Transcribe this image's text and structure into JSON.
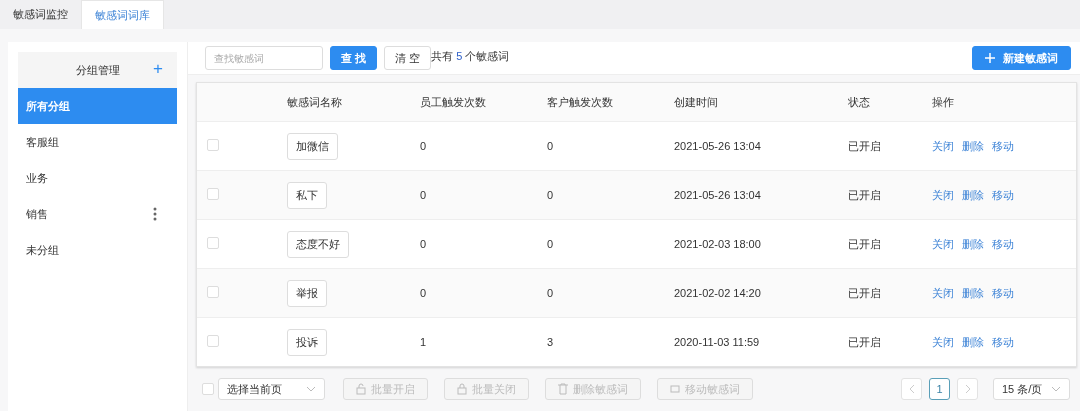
{
  "tabs": [
    {
      "label": "敏感词监控",
      "selected": false
    },
    {
      "label": "敏感词词库",
      "selected": true
    }
  ],
  "sidebar": {
    "title": "分组管理",
    "add_icon": "+",
    "items": [
      {
        "label": "所有分组",
        "selected": true,
        "menu": false
      },
      {
        "label": "客服组",
        "selected": false,
        "menu": false
      },
      {
        "label": "业务",
        "selected": false,
        "menu": false
      },
      {
        "label": "销售",
        "selected": false,
        "menu": true
      },
      {
        "label": "未分组",
        "selected": false,
        "menu": false
      }
    ]
  },
  "toolbar": {
    "search": {
      "placeholder": "查找敏感词"
    },
    "search_button": "查 找",
    "clear_button": "清 空",
    "summary": {
      "prefix": "共有",
      "count": "5",
      "suffix": "个敏感词"
    },
    "new_button": "新建敏感词"
  },
  "table": {
    "columns": [
      "敏感词名称",
      "员工触发次数",
      "客户触发次数",
      "创建时间",
      "状态",
      "操作"
    ],
    "rows": [
      {
        "checked": false,
        "word": "加微信",
        "staff_count": "0",
        "customer_count": "0",
        "created": "2021-05-26 13:04",
        "status": "已开启",
        "actions": [
          "关闭",
          "删除",
          "移动"
        ]
      },
      {
        "checked": false,
        "word": "私下",
        "staff_count": "0",
        "customer_count": "0",
        "created": "2021-05-26 13:04",
        "status": "已开启",
        "actions": [
          "关闭",
          "删除",
          "移动"
        ]
      },
      {
        "checked": false,
        "word": "态度不好",
        "staff_count": "0",
        "customer_count": "0",
        "created": "2021-02-03 18:00",
        "status": "已开启",
        "actions": [
          "关闭",
          "删除",
          "移动"
        ]
      },
      {
        "checked": false,
        "word": "举报",
        "staff_count": "0",
        "customer_count": "0",
        "created": "2021-02-02 14:20",
        "status": "已开启",
        "actions": [
          "关闭",
          "删除",
          "移动"
        ]
      },
      {
        "checked": false,
        "word": "投诉",
        "staff_count": "1",
        "customer_count": "3",
        "created": "2020-11-03 11:59",
        "status": "已开启",
        "actions": [
          "关闭",
          "删除",
          "移动"
        ]
      }
    ]
  },
  "footer": {
    "select_all": {
      "checked": false
    },
    "page_select": "选择当前页",
    "bulk_buttons": [
      {
        "kind": "unlock",
        "label": "批量开启",
        "disabled": true
      },
      {
        "kind": "lock",
        "label": "批量关闭",
        "disabled": true
      },
      {
        "kind": "trash",
        "label": "删除敏感词",
        "disabled": true
      },
      {
        "kind": "move",
        "label": "移动敏感词",
        "disabled": true
      }
    ],
    "pagination": {
      "pages": [
        {
          "label": "1",
          "selected": true
        }
      ],
      "page_size": "15 条/页"
    }
  }
}
